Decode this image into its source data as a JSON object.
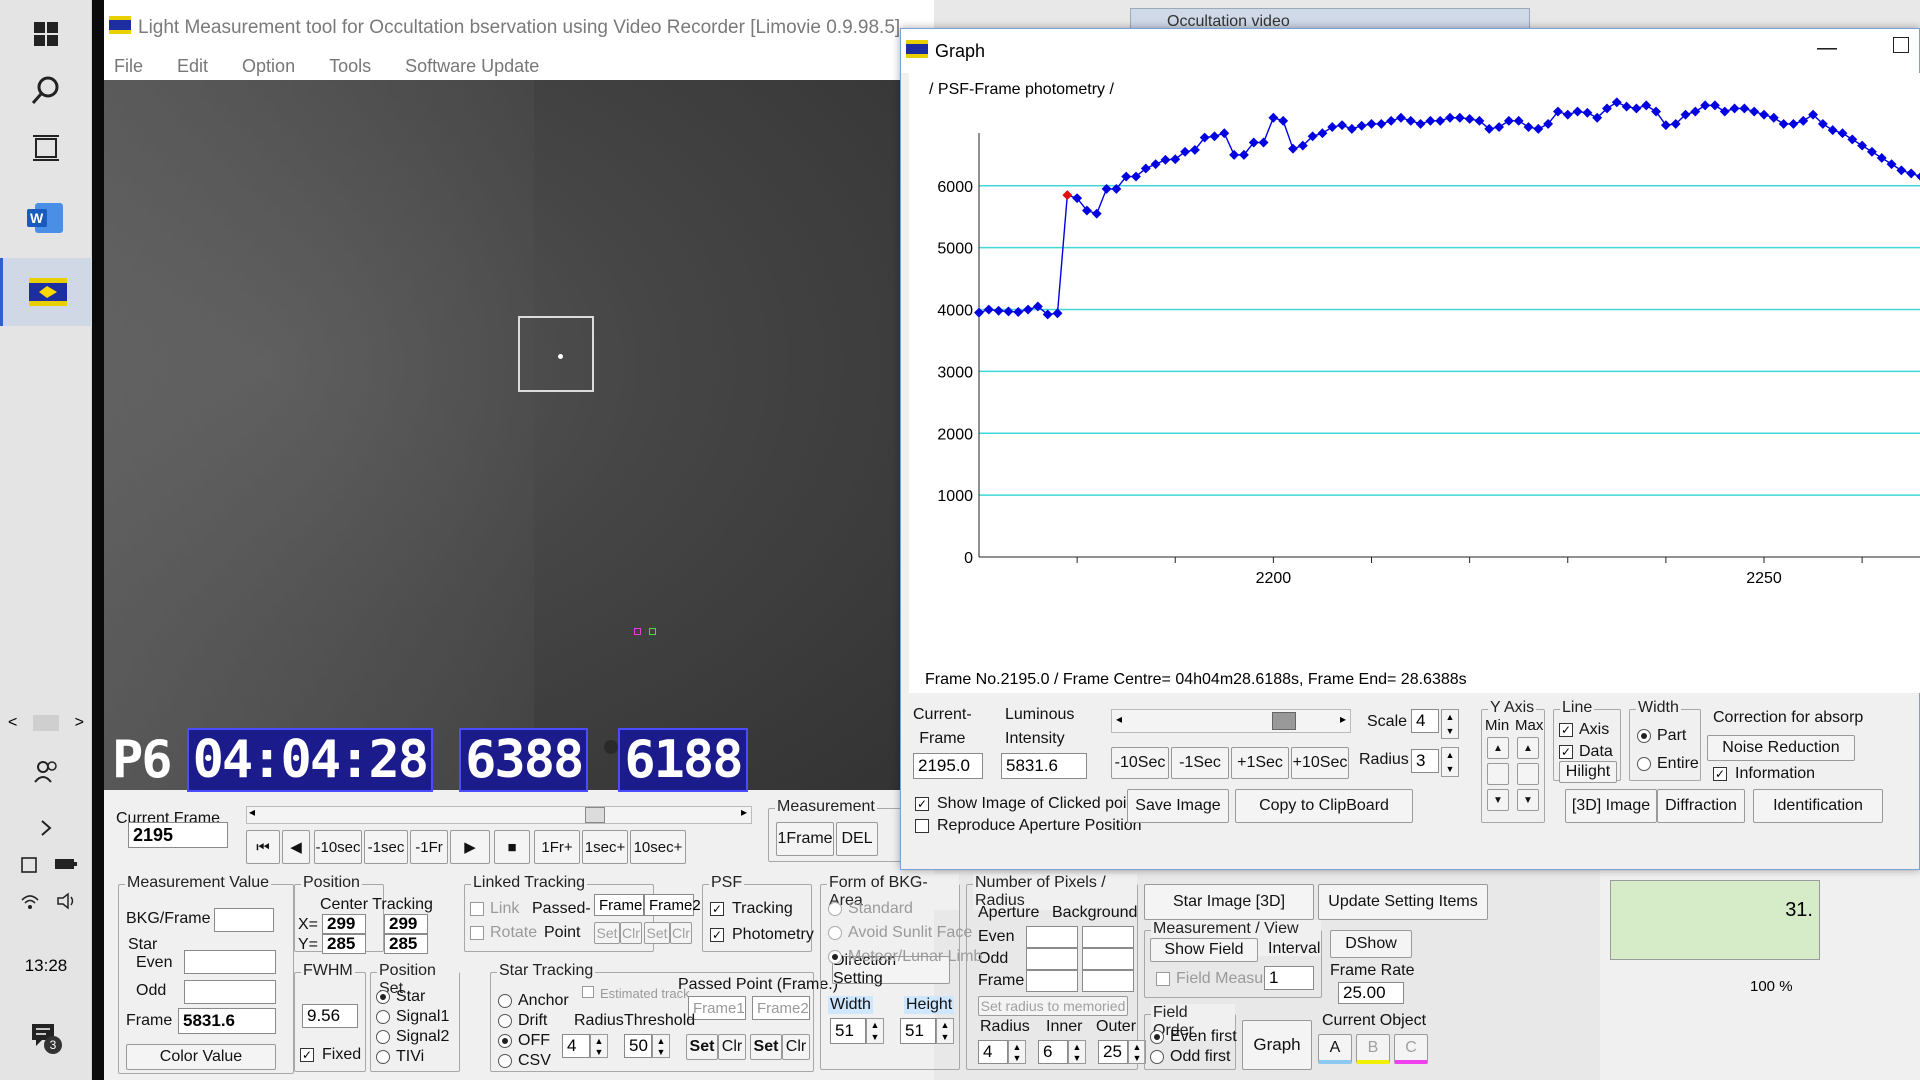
{
  "taskbar": {
    "clock": "13:28",
    "notification_count": "3"
  },
  "main": {
    "title": "Light Measurement tool for Occultation bservation using Video Recorder [Limovie 0.9.98.5]",
    "menu": [
      "File",
      "Edit",
      "Option",
      "Tools",
      "Software Update"
    ],
    "osd": {
      "p": "P6",
      "time": "04:04:28",
      "a": "6388",
      "b": "6188"
    },
    "current_frame": {
      "label": "Current Frame",
      "value": "2195"
    },
    "playback": {
      "first": "⏮",
      "prev": "◀",
      "m10": "-10sec",
      "m1": "-1sec",
      "m1fr": "-1Fr",
      "play": "▶",
      "stop": "■",
      "p1fr": "1Fr+",
      "p1": "1sec+",
      "p10": "10sec+"
    },
    "measurement": {
      "label": "Measurement",
      "one": "1Frame",
      "del": "DEL"
    },
    "mv": {
      "label": "Measurement Value",
      "bkg": "BKG/Frame",
      "star": "Star",
      "even": "Even",
      "odd": "Odd",
      "frame": "Frame",
      "frame_value": "5831.6",
      "color": "Color Value"
    },
    "position": {
      "label": "Position",
      "ct": "Center Tracking",
      "x": "X=",
      "y": "Y=",
      "x1": "299",
      "x2": "299",
      "y1": "285",
      "y2": "285"
    },
    "fwhm": {
      "label": "FWHM",
      "value": "9.56",
      "fixed": "Fixed"
    },
    "posset": {
      "label": "Position Set",
      "opts": [
        "Star",
        "Signal1",
        "Signal2",
        "TIVi"
      ]
    },
    "linked": {
      "label": "Linked Tracking",
      "link": "Link",
      "passed": "Passed-",
      "f1": "Frame1",
      "f2": "Frame2",
      "rotate": "Rotate",
      "point": "Point",
      "set": "Set",
      "clr": "Clr"
    },
    "psf": {
      "label": "PSF",
      "tracking": "Tracking",
      "photometry": "Photometry"
    },
    "startrack": {
      "label": "Star Tracking",
      "opts": [
        "Anchor",
        "Drift",
        "OFF",
        "CSV"
      ],
      "est": "Estimated track",
      "radius": "Radius",
      "threshold": "Threshold",
      "rv": "4",
      "tv": "50",
      "passed": "Passed Point (Frame.)",
      "f1": "Frame1",
      "f2": "Frame2",
      "set": "Set",
      "clr": "Clr"
    },
    "bkg": {
      "label": "Form of BKG-Area",
      "opts": [
        "Standard",
        "Avoid Sunlit Face",
        "Meteor/Lunar Limb"
      ],
      "dir": "Direction Setting",
      "width": "Width",
      "height": "Height",
      "wv": "51",
      "hv": "51"
    },
    "pixels": {
      "label": "Number of Pixels / Radius",
      "aperture": "Aperture",
      "background": "Background",
      "even": "Even",
      "odd": "Odd",
      "frame": "Frame",
      "set_radius": "Set  radius to memoried",
      "radius": "Radius",
      "inner": "Inner",
      "outer": "Outer",
      "rv": "4",
      "iv": "6",
      "ov": "25"
    },
    "right": {
      "star3d": "Star Image [3D]",
      "update": "Update Setting Items",
      "mvo": "Measurement / View Option",
      "show_field": "Show Field",
      "interval": "Interval",
      "field_measure": "Field Measure",
      "iv": "1",
      "dshow": "DShow",
      "frame_rate": "Frame Rate",
      "fr": "25.00",
      "field_order": "Field Order",
      "even_first": "Even first",
      "odd_first": "Odd first",
      "graph": "Graph",
      "current_object": "Current Object",
      "a": "A",
      "b": "B",
      "c": "C"
    }
  },
  "behind": {
    "title": "Occultation video",
    "cell": "31.",
    "zoom": "100 %"
  },
  "graph": {
    "title": "Graph",
    "heading": "/ PSF-Frame photometry /",
    "status": "Frame No.2195.0 / Frame Centre= 04h04m28.6188s,  Frame End= 28.6388s",
    "current_frame_label": "Current-\nFrame",
    "current_frame": "2195.0",
    "luminous_label": "Luminous\nIntensity",
    "luminous": "5831.6",
    "nav": [
      "-10Sec",
      "-1Sec",
      "+1Sec",
      "+10Sec"
    ],
    "scale": "Scale",
    "scale_v": "4",
    "radius": "Radius",
    "radius_v": "3",
    "show_image": "Show Image of Clicked point",
    "reproduce": "Reproduce Aperture Position",
    "save": "Save Image",
    "copy": "Copy to ClipBoard",
    "yaxis": "Y Axis",
    "min": "Min",
    "max": "Max",
    "line": "Line",
    "axis": "Axis",
    "data": "Data",
    "hilight": "Hilight",
    "width": "Width",
    "part": "Part",
    "entire": "Entire",
    "img3d": "[3D] Image",
    "diffraction": "Diffraction",
    "correction": "Correction for absorp",
    "noise": "Noise Reduction",
    "information": "Information",
    "identification": "Identification"
  },
  "chart_data": {
    "type": "line",
    "title": "/ PSF-Frame photometry /",
    "xlim": [
      2170,
      2266
    ],
    "ylim": [
      0,
      7500
    ],
    "xticks": [
      2200,
      2250
    ],
    "yticks": [
      0,
      1000,
      2000,
      3000,
      4000,
      5000,
      6000
    ],
    "highlight_x": 2179,
    "series": [
      {
        "color": "#0000e0",
        "x": [
          2170,
          2171,
          2172,
          2173,
          2174,
          2175,
          2176,
          2177,
          2178,
          2179,
          2180,
          2181,
          2182,
          2183,
          2184,
          2185,
          2186,
          2187,
          2188,
          2189,
          2190,
          2191,
          2192,
          2193,
          2194,
          2195,
          2196,
          2197,
          2198,
          2199,
          2200,
          2201,
          2202,
          2203,
          2204,
          2205,
          2206,
          2207,
          2208,
          2209,
          2210,
          2211,
          2212,
          2213,
          2214,
          2215,
          2216,
          2217,
          2218,
          2219,
          2220,
          2221,
          2222,
          2223,
          2224,
          2225,
          2226,
          2227,
          2228,
          2229,
          2230,
          2231,
          2232,
          2233,
          2234,
          2235,
          2236,
          2237,
          2238,
          2239,
          2240,
          2241,
          2242,
          2243,
          2244,
          2245,
          2246,
          2247,
          2248,
          2249,
          2250,
          2251,
          2252,
          2253,
          2254,
          2255,
          2256,
          2257,
          2258,
          2259,
          2260,
          2261,
          2262,
          2263,
          2264,
          2265,
          2266
        ],
        "y": [
          3950,
          4000,
          3980,
          3970,
          3960,
          4000,
          4050,
          3920,
          3940,
          5850,
          5800,
          5600,
          5550,
          5950,
          5950,
          6150,
          6150,
          6280,
          6350,
          6420,
          6430,
          6550,
          6580,
          6780,
          6800,
          6850,
          6500,
          6500,
          6700,
          6700,
          7100,
          7050,
          6600,
          6650,
          6800,
          6850,
          6950,
          6980,
          6920,
          6970,
          7000,
          7000,
          7050,
          7100,
          7050,
          7000,
          7050,
          7050,
          7100,
          7100,
          7080,
          7050,
          6920,
          6950,
          7050,
          7050,
          6950,
          6920,
          7000,
          7200,
          7150,
          7200,
          7180,
          7100,
          7250,
          7350,
          7280,
          7250,
          7300,
          7200,
          6980,
          7000,
          7150,
          7200,
          7300,
          7300,
          7200,
          7250,
          7250,
          7200,
          7150,
          7100,
          7000,
          7000,
          7050,
          7150,
          7000,
          6900,
          6850,
          6750,
          6650,
          6550,
          6450,
          6350,
          6250,
          6200,
          6150
        ]
      }
    ]
  }
}
